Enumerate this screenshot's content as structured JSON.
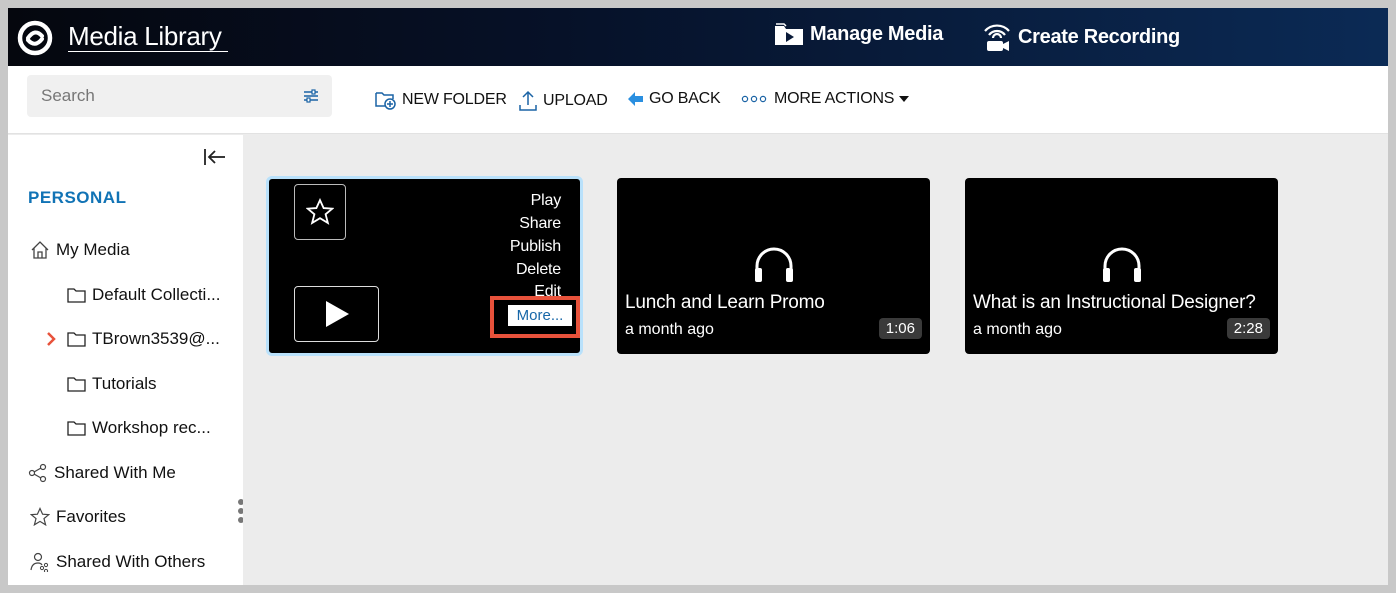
{
  "header": {
    "app_title": "Media Library",
    "manage_media": "Manage Media",
    "create_recording": "Create Recording"
  },
  "toolbar": {
    "search_placeholder": "Search",
    "new_folder": "NEW FOLDER",
    "upload": "UPLOAD",
    "go_back": "GO BACK",
    "more_actions": "MORE ACTIONS"
  },
  "sidebar": {
    "section_title": "PERSONAL",
    "my_media": "My Media",
    "folders": [
      {
        "label": "Default Collecti..."
      },
      {
        "label": "TBrown3539@..."
      },
      {
        "label": "Tutorials"
      },
      {
        "label": "Workshop rec..."
      }
    ],
    "shared_with_me": "Shared With Me",
    "favorites": "Favorites",
    "shared_with_others": "Shared With Others"
  },
  "cards": [
    {
      "menu": [
        "Play",
        "Share",
        "Publish",
        "Delete",
        "Edit"
      ],
      "more": "More..."
    },
    {
      "title": "Lunch and Learn Promo",
      "date": "a month ago",
      "duration": "1:06",
      "icon": "headphones-icon"
    },
    {
      "title": "What is an Instructional Designer?",
      "date": "a month ago",
      "duration": "2:28",
      "icon": "headphones-icon"
    }
  ],
  "colors": {
    "accent_blue": "#1173b5",
    "highlight_red": "#e8523b",
    "selected_border": "#b9e1fb",
    "header_dark": "#061128"
  }
}
